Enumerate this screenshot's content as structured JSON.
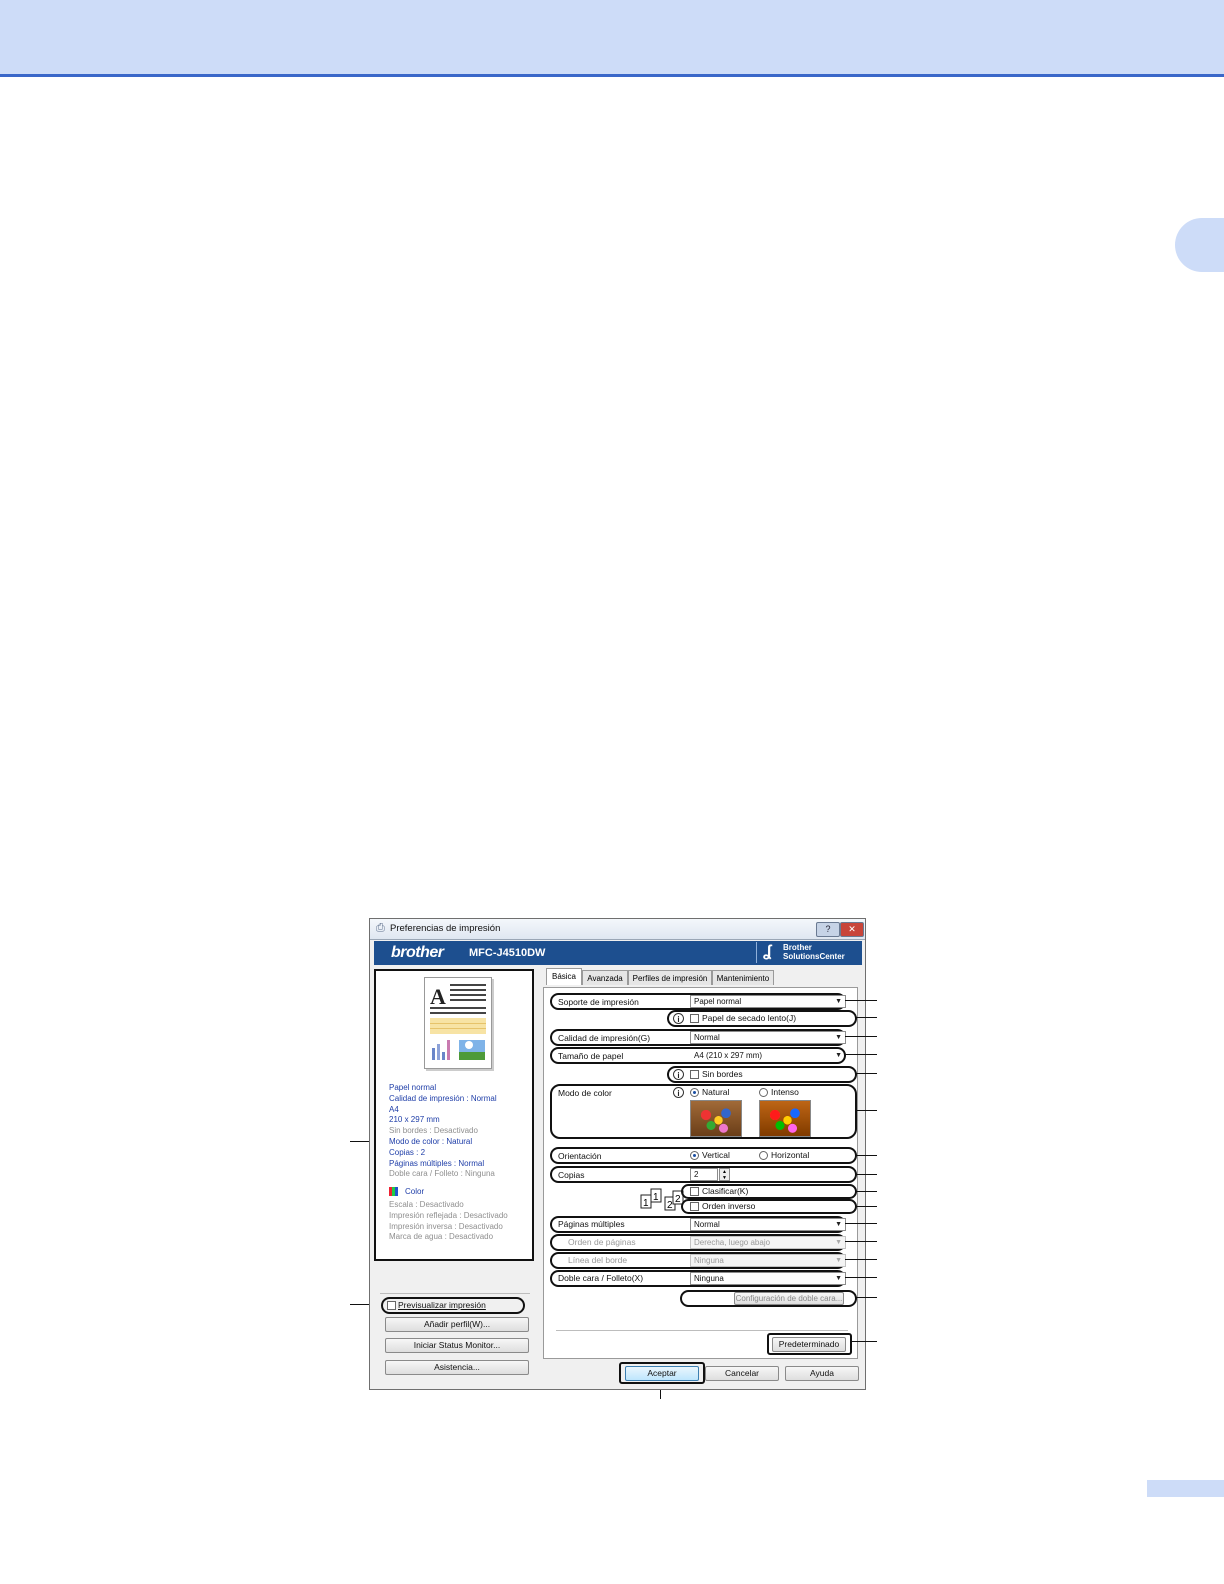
{
  "window": {
    "title": "Preferencias de impresión",
    "help_button": "?",
    "close_button": "✕"
  },
  "banner": {
    "logo": "brother",
    "model": "MFC-J4510DW",
    "solutions_line1": "Brother",
    "solutions_line2": "SolutionsCenter"
  },
  "summary": {
    "lines_blue_top": [
      "Papel normal",
      "Calidad de impresión : Normal",
      "A4",
      "210 x 297 mm"
    ],
    "line_gray_1": "Sin bordes : Desactivado",
    "lines_blue_mid": [
      "Modo de color : Natural",
      "Copias : 2",
      "Páginas múltiples : Normal"
    ],
    "line_gray_2": "Doble cara / Folleto : Ninguna",
    "color_label": "Color",
    "extras": [
      "Escala : Desactivado",
      "Impresión reflejada : Desactivado",
      "Impresión inversa : Desactivado",
      "Marca de agua : Desactivado"
    ]
  },
  "left_controls": {
    "preview_label": "Previsualizar impresión",
    "add_profile": "Añadir perfil(W)...",
    "status_monitor": "Iniciar Status Monitor...",
    "support": "Asistencia..."
  },
  "tabs": [
    "Básica",
    "Avanzada",
    "Perfiles de impresión",
    "Mantenimiento"
  ],
  "form": {
    "media_label": "Soporte de impresión",
    "media_value": "Papel normal",
    "slow_dry_label": "Papel de secado lento(J)",
    "quality_label": "Calidad de impresión(G)",
    "quality_value": "Normal",
    "paper_size_label": "Tamaño de papel",
    "paper_size_value": "A4 (210 x 297 mm)",
    "borderless_label": "Sin bordes",
    "color_mode_label": "Modo de color",
    "color_natural": "Natural",
    "color_vivid": "Intenso",
    "orientation_label": "Orientación",
    "orientation_portrait": "Vertical",
    "orientation_landscape": "Horizontal",
    "copies_label": "Copias",
    "copies_value": "2",
    "collate_label": "Clasificar(K)",
    "reverse_label": "Orden inverso",
    "multi_page_label": "Páginas múltiples",
    "multi_page_value": "Normal",
    "page_order_label": "Orden de páginas",
    "page_order_value": "Derecha, luego abajo",
    "border_line_label": "Línea del borde",
    "border_line_value": "Ninguna",
    "duplex_label": "Doble cara / Folleto(X)",
    "duplex_value": "Ninguna",
    "duplex_settings": "Configuración de doble cara...",
    "default_button": "Predeterminado"
  },
  "footer": {
    "ok": "Aceptar",
    "cancel": "Cancelar",
    "help": "Ayuda"
  },
  "colors": {
    "header_band": "#cddcf8",
    "header_rule": "#3a67c9",
    "banner": "#1d4f8f",
    "summary_blue": "#1f3ea8"
  }
}
